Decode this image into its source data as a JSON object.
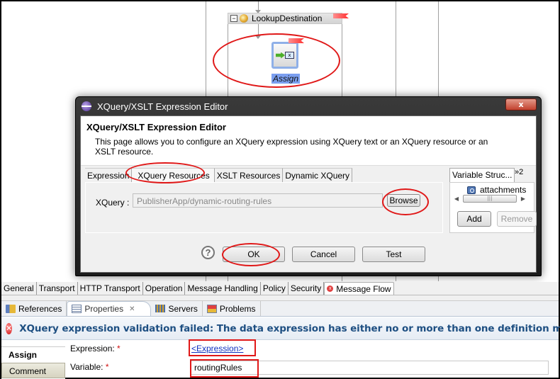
{
  "canvas": {
    "stage_label": "LookupDestination",
    "assign_node_label": "Assign"
  },
  "dialog": {
    "window_title": "XQuery/XSLT Expression Editor",
    "close_label": "x",
    "header_title": "XQuery/XSLT Expression Editor",
    "header_description": "This page allows you to configure an XQuery expression using XQuery text or an XQuery resource or an XSLT resource.",
    "tabs": [
      {
        "label": "Expression",
        "active": false
      },
      {
        "label": "XQuery Resources",
        "active": true
      },
      {
        "label": "XSLT Resources",
        "active": false
      },
      {
        "label": "Dynamic XQuery",
        "active": false
      }
    ],
    "xquery_label": "XQuery :",
    "xquery_value": "PublisherApp/dynamic-routing-rules",
    "browse_label": "Browse",
    "side_panel": {
      "tab_label": "Variable Struc...",
      "overflow_label": "»2",
      "tree_items": [
        "attachments"
      ],
      "add_label": "Add",
      "remove_label": "Remove"
    },
    "help_label": "?",
    "ok_label": "OK",
    "cancel_label": "Cancel",
    "test_label": "Test"
  },
  "proxy_tabs": [
    {
      "label": "General"
    },
    {
      "label": "Transport"
    },
    {
      "label": "HTTP Transport"
    },
    {
      "label": "Operation"
    },
    {
      "label": "Message Handling"
    },
    {
      "label": "Policy"
    },
    {
      "label": "Security"
    },
    {
      "label": "Message Flow",
      "error": true,
      "active": true
    }
  ],
  "view_tabs": [
    {
      "label": "References",
      "icon": "references-icon"
    },
    {
      "label": "Properties",
      "icon": "properties-icon",
      "active": true,
      "close": "✕"
    },
    {
      "label": "Servers",
      "icon": "servers-icon"
    },
    {
      "label": "Problems",
      "icon": "problems-icon"
    }
  ],
  "properties": {
    "error_message": "XQuery expression validation failed: The data expression has either no or more than one definition method.",
    "side_tabs": [
      "Assign",
      "Comment"
    ],
    "expression_label": "Expression:",
    "expression_value": "<Expression>",
    "variable_label": "Variable:",
    "variable_value": "routingRules",
    "required_marker": "*"
  }
}
